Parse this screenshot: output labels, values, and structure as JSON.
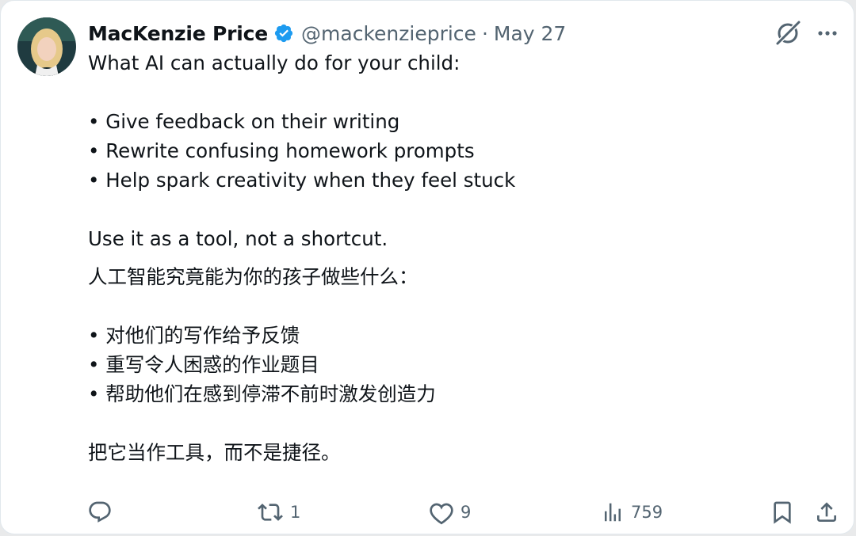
{
  "tweet": {
    "author_name": "MacKenzie Price",
    "handle": "@mackenzieprice",
    "separator": "·",
    "date": "May 27",
    "verified_color": "#1d9bf0",
    "body": {
      "intro_en": "What AI can actually do for your child:",
      "bullets_en": [
        "• Give feedback on their writing",
        "• Rewrite confusing homework prompts",
        "• Help spark creativity when they feel stuck"
      ],
      "closing_en": "Use it as a tool, not a shortcut.",
      "intro_zh": "人工智能究竟能为你的孩子做些什么：",
      "bullets_zh": [
        "• 对他们的写作给予反馈",
        "• 重写令人困惑的作业题目",
        "• 帮助他们在感到停滞不前时激发创造力"
      ],
      "closing_zh": "把它当作工具，而不是捷径。"
    },
    "actions": {
      "reply_icon": "reply-icon",
      "retweet_icon": "retweet-icon",
      "retweet_count": "1",
      "like_icon": "heart-icon",
      "like_count": "9",
      "views_icon": "bar-chart-icon",
      "views_count": "759",
      "bookmark_icon": "bookmark-icon",
      "share_icon": "share-icon"
    },
    "colors": {
      "text": "#0f1419",
      "secondary": "#536471"
    }
  }
}
